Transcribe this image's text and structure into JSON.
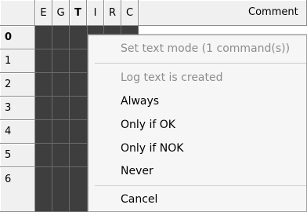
{
  "grid": {
    "columns": [
      {
        "label": "E",
        "bold": false
      },
      {
        "label": "G",
        "bold": false
      },
      {
        "label": "T",
        "bold": true
      },
      {
        "label": "I",
        "bold": false
      },
      {
        "label": "R",
        "bold": false
      },
      {
        "label": "C",
        "bold": false
      }
    ],
    "comment_header": "Comment",
    "rows": [
      "0",
      "1",
      "2",
      "3",
      "4",
      "5",
      "6"
    ],
    "selected_row": "0",
    "colors": {
      "header_bg": "#f0f0f0",
      "cell_dark": "#3e3e3e",
      "grid_line": "#8c8c8c"
    }
  },
  "context_menu": {
    "items": [
      {
        "label": "Set text mode (1 command(s))",
        "enabled": false
      },
      {
        "separator": true
      },
      {
        "label": "Log text is created",
        "enabled": false
      },
      {
        "label": "Always",
        "enabled": true
      },
      {
        "label": "Only if OK",
        "enabled": true
      },
      {
        "label": "Only if NOK",
        "enabled": true
      },
      {
        "label": "Never",
        "enabled": true
      },
      {
        "separator": true
      },
      {
        "label": "Cancel",
        "enabled": true
      }
    ],
    "colors": {
      "background": "#f6f6f6",
      "disabled_text": "#8d8d8d",
      "border": "#a0a0a0"
    }
  }
}
